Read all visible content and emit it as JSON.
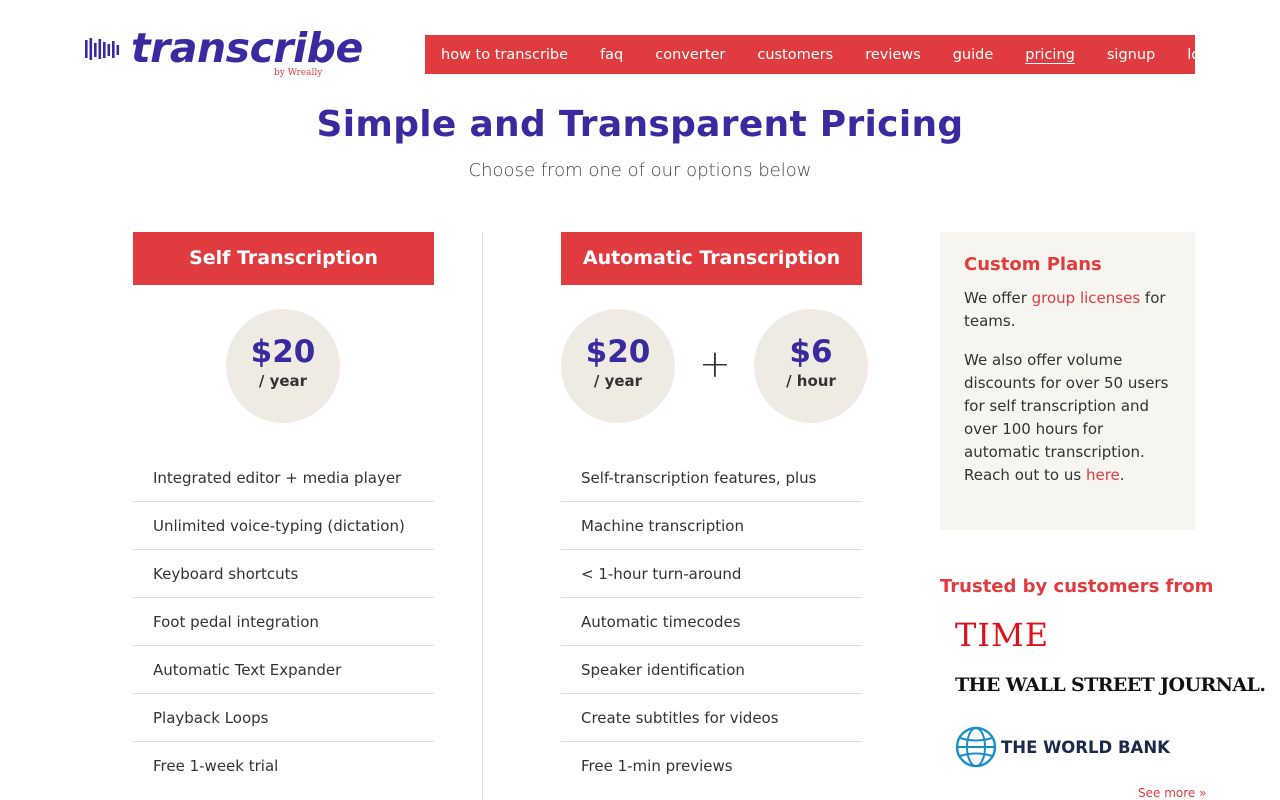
{
  "brand": {
    "name": "transcribe",
    "byline": "by Wreally",
    "primary_color": "#3a2aa0",
    "accent_color": "#e03c3f"
  },
  "nav": {
    "items": [
      {
        "label": "how to transcribe"
      },
      {
        "label": "faq"
      },
      {
        "label": "converter"
      },
      {
        "label": "customers"
      },
      {
        "label": "reviews"
      },
      {
        "label": "guide"
      },
      {
        "label": "pricing",
        "active": true
      },
      {
        "label": "signup"
      },
      {
        "label": "login"
      }
    ]
  },
  "page": {
    "title": "Simple and Transparent Pricing",
    "subtitle": "Choose from one of our options below"
  },
  "plans": {
    "self": {
      "title": "Self Transcription",
      "price": {
        "amount": "$20",
        "unit": "/ year"
      },
      "features": [
        "Integrated editor + media player",
        "Unlimited voice-typing (dictation)",
        "Keyboard shortcuts",
        "Foot pedal integration",
        "Automatic Text Expander",
        "Playback Loops",
        "Free 1-week trial"
      ]
    },
    "auto": {
      "title": "Automatic Transcription",
      "price_year": {
        "amount": "$20",
        "unit": "/ year"
      },
      "plus": "+",
      "price_hour": {
        "amount": "$6",
        "unit": "/ hour"
      },
      "features": [
        "Self-transcription features, plus",
        "Machine transcription",
        "< 1-hour turn-around",
        "Automatic timecodes",
        "Speaker identification",
        "Create subtitles for videos",
        "Free 1-min previews"
      ]
    }
  },
  "custom": {
    "title": "Custom Plans",
    "p1_before": "We offer ",
    "p1_link": "group licenses",
    "p1_after": " for teams.",
    "p2_before": "We also offer volume discounts for over 50 users for self transcription and over 100 hours for automatic transcription. Reach out to us ",
    "p2_link": "here",
    "p2_after": "."
  },
  "trusted": {
    "title": "Trusted by customers from",
    "logos": [
      "TIME",
      "THE WALL STREET JOURNAL.",
      "THE WORLD BANK"
    ],
    "see_more": "See more »"
  },
  "icons": {
    "logo": "sound-wave-icon",
    "world_bank": "globe-icon"
  }
}
